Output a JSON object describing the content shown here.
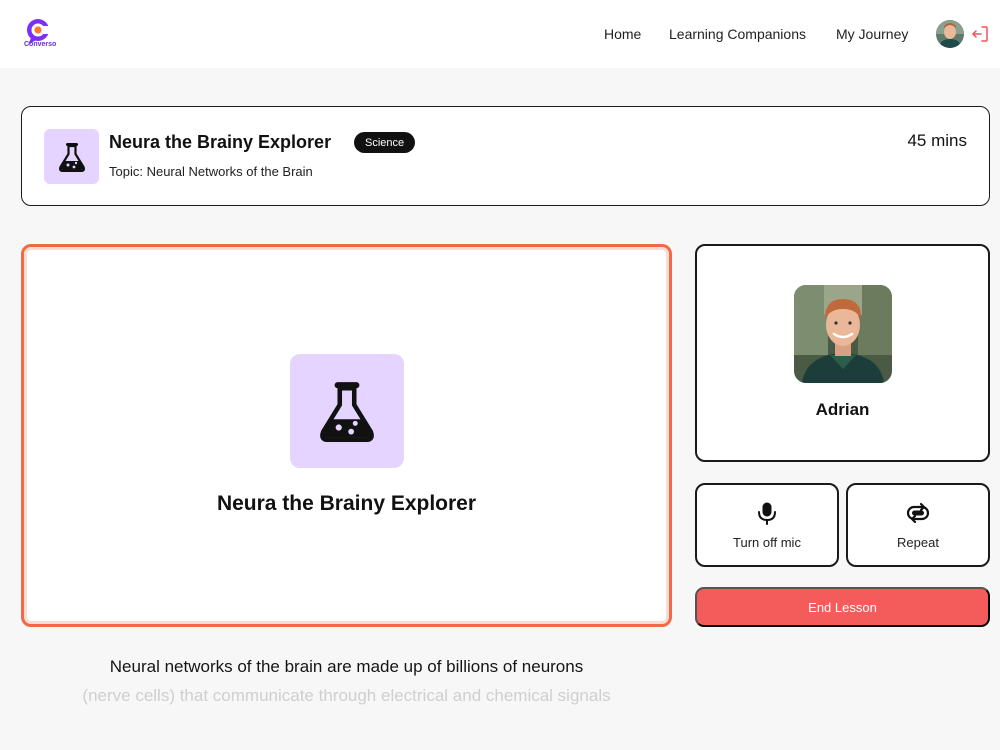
{
  "app": {
    "name": "Converso",
    "brand_color": "#6a2bd9",
    "accent_color": "#f26a45"
  },
  "nav": {
    "links": [
      {
        "label": "Home"
      },
      {
        "label": "Learning Companions"
      },
      {
        "label": "My Journey"
      }
    ],
    "avatar_icon": "user-avatar",
    "logout_icon": "logout-icon"
  },
  "session": {
    "companion_name": "Neura the Brainy Explorer",
    "subject": "Science",
    "topic": "Topic: Neural Networks of the Brain",
    "duration": "45 mins",
    "subject_icon": "flask-icon",
    "subject_color": "#e4d4ff"
  },
  "stage": {
    "companion_name": "Neura the Brainy Explorer",
    "status": "speaking"
  },
  "user": {
    "name": "Adrian"
  },
  "controls": {
    "mic_label": "Turn off mic",
    "mic_icon": "microphone-icon",
    "repeat_label": "Repeat",
    "repeat_icon": "repeat-icon",
    "end_label": "End Lesson",
    "end_color": "#f45b5b"
  },
  "transcript": {
    "current": "Neural networks of the brain are made up of billions of neurons",
    "next": "(nerve cells) that communicate through electrical and chemical signals"
  }
}
